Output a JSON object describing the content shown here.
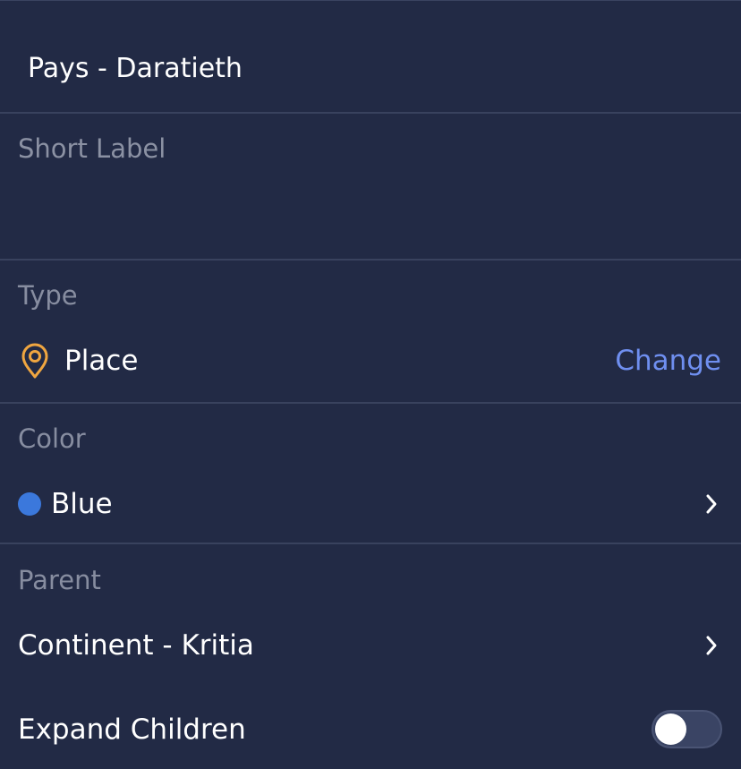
{
  "header": {
    "title": "Pays - Daratieth"
  },
  "short_label": {
    "placeholder": "Short Label",
    "value": ""
  },
  "type_section": {
    "label": "Type",
    "value": "Place",
    "icon": "map-pin-icon",
    "action_label": "Change"
  },
  "color_section": {
    "label": "Color",
    "value": "Blue",
    "swatch": "#3b78dc"
  },
  "parent_section": {
    "label": "Parent",
    "value": "Continent - Kritia"
  },
  "expand_children": {
    "label": "Expand Children",
    "enabled": false
  },
  "colors": {
    "background": "#222a45",
    "divider": "#39425e",
    "accent": "#6f8ff0",
    "pin_icon": "#f0a640"
  }
}
